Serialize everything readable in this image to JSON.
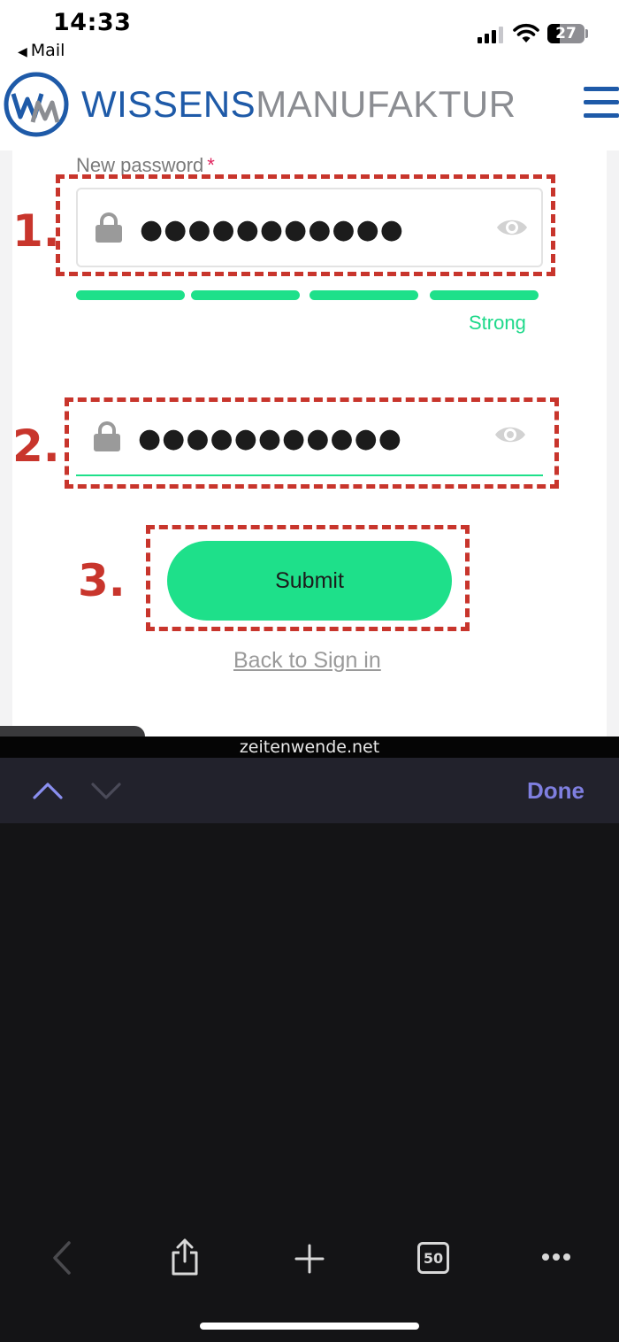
{
  "status_bar": {
    "time": "14:33",
    "back_app": "Mail",
    "battery": "27"
  },
  "site": {
    "brand_bold": "WISSENS",
    "brand_light": "MANUFAKTUR"
  },
  "form": {
    "new_password_label": "New password",
    "required_marker": "*",
    "new_password_value": "●●●●●●●●●●●",
    "confirm_password_value": "●●●●●●●●●●●",
    "strength": {
      "label": "Strong",
      "segments_filled": 4,
      "segments_total": 4
    },
    "submit_label": "Submit",
    "back_link": "Back to Sign in"
  },
  "annotations": [
    "1.",
    "2.",
    "3."
  ],
  "browser": {
    "url": "zeitenwende.net",
    "done_label": "Done",
    "tab_count": "50"
  },
  "colors": {
    "brand_blue": "#1e5aa8",
    "accent_green": "#1ee08a",
    "annotation_red": "#c8352c",
    "done_purple": "#7f7fe0"
  }
}
